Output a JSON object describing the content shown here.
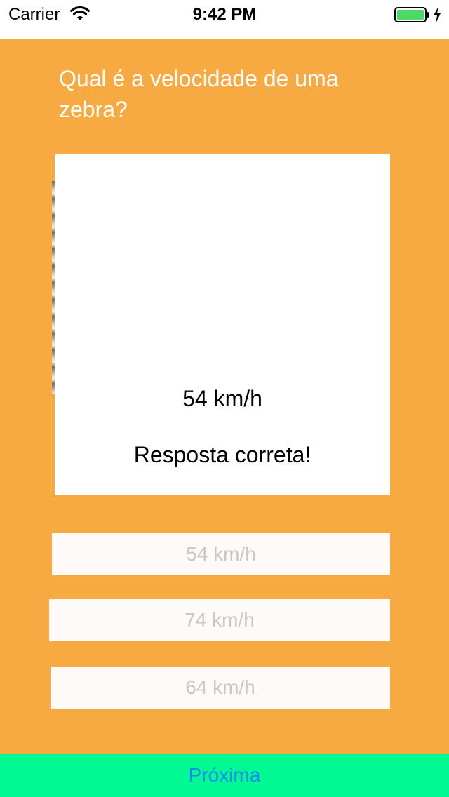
{
  "status_bar": {
    "carrier": "Carrier",
    "time": "9:42 PM",
    "battery_color": "#4cd964"
  },
  "quiz": {
    "question": "Qual é a velocidade de uma zebra?",
    "answer_card": {
      "value": "54 km/h",
      "feedback": "Resposta correta!"
    },
    "options": [
      "54 km/h",
      "74 km/h",
      "64 km/h"
    ],
    "next_label": "Próxima"
  },
  "colors": {
    "background": "#f7aa41",
    "next_bar": "#00fa92",
    "next_text": "#1e88f5",
    "option_text": "#c8c8c8"
  }
}
